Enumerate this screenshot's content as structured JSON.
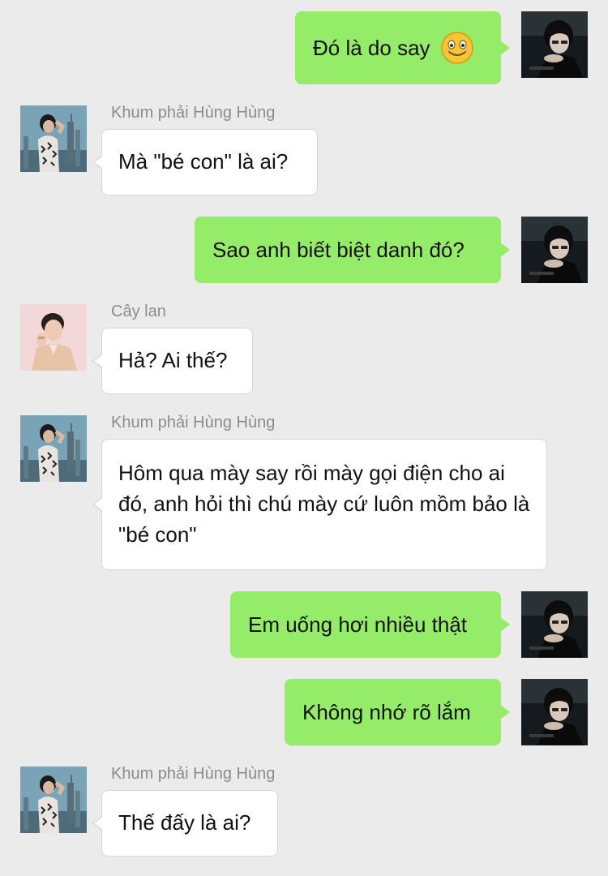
{
  "people": {
    "me": {
      "avatar_icon": "dark-portrait-avatar-icon"
    },
    "hung": {
      "name": "Khum phải Hùng Hùng",
      "avatar_icon": "city-portrait-avatar-icon"
    },
    "cay": {
      "name": "Cây lan",
      "avatar_icon": "pink-portrait-avatar-icon"
    }
  },
  "messages": [
    {
      "from": "me",
      "text": "Đó là do say",
      "emoji": "smile-emoji-icon"
    },
    {
      "from": "hung",
      "sender": "Khum phải Hùng Hùng",
      "text": "Mà \"bé con\" là ai?"
    },
    {
      "from": "me",
      "text": "Sao anh biết biệt danh đó?"
    },
    {
      "from": "cay",
      "sender": "Cây lan",
      "text": "Hả? Ai thế?"
    },
    {
      "from": "hung",
      "sender": "Khum phải Hùng Hùng",
      "text": "Hôm qua mày say rồi mày gọi điện cho ai đó, anh hỏi thì chú mày cứ luôn mồm bảo là \"bé con\""
    },
    {
      "from": "me",
      "text": "Em uống hơi nhiều thật"
    },
    {
      "from": "me",
      "text": "Không nhớ rõ lắm"
    },
    {
      "from": "hung",
      "sender": "Khum phải Hùng Hùng",
      "text": "Thế đấy là ai?"
    }
  ],
  "colors": {
    "background": "#ebebeb",
    "outgoing_bubble": "#95ec69",
    "incoming_bubble": "#ffffff",
    "sender_name": "#8c8c8c"
  }
}
